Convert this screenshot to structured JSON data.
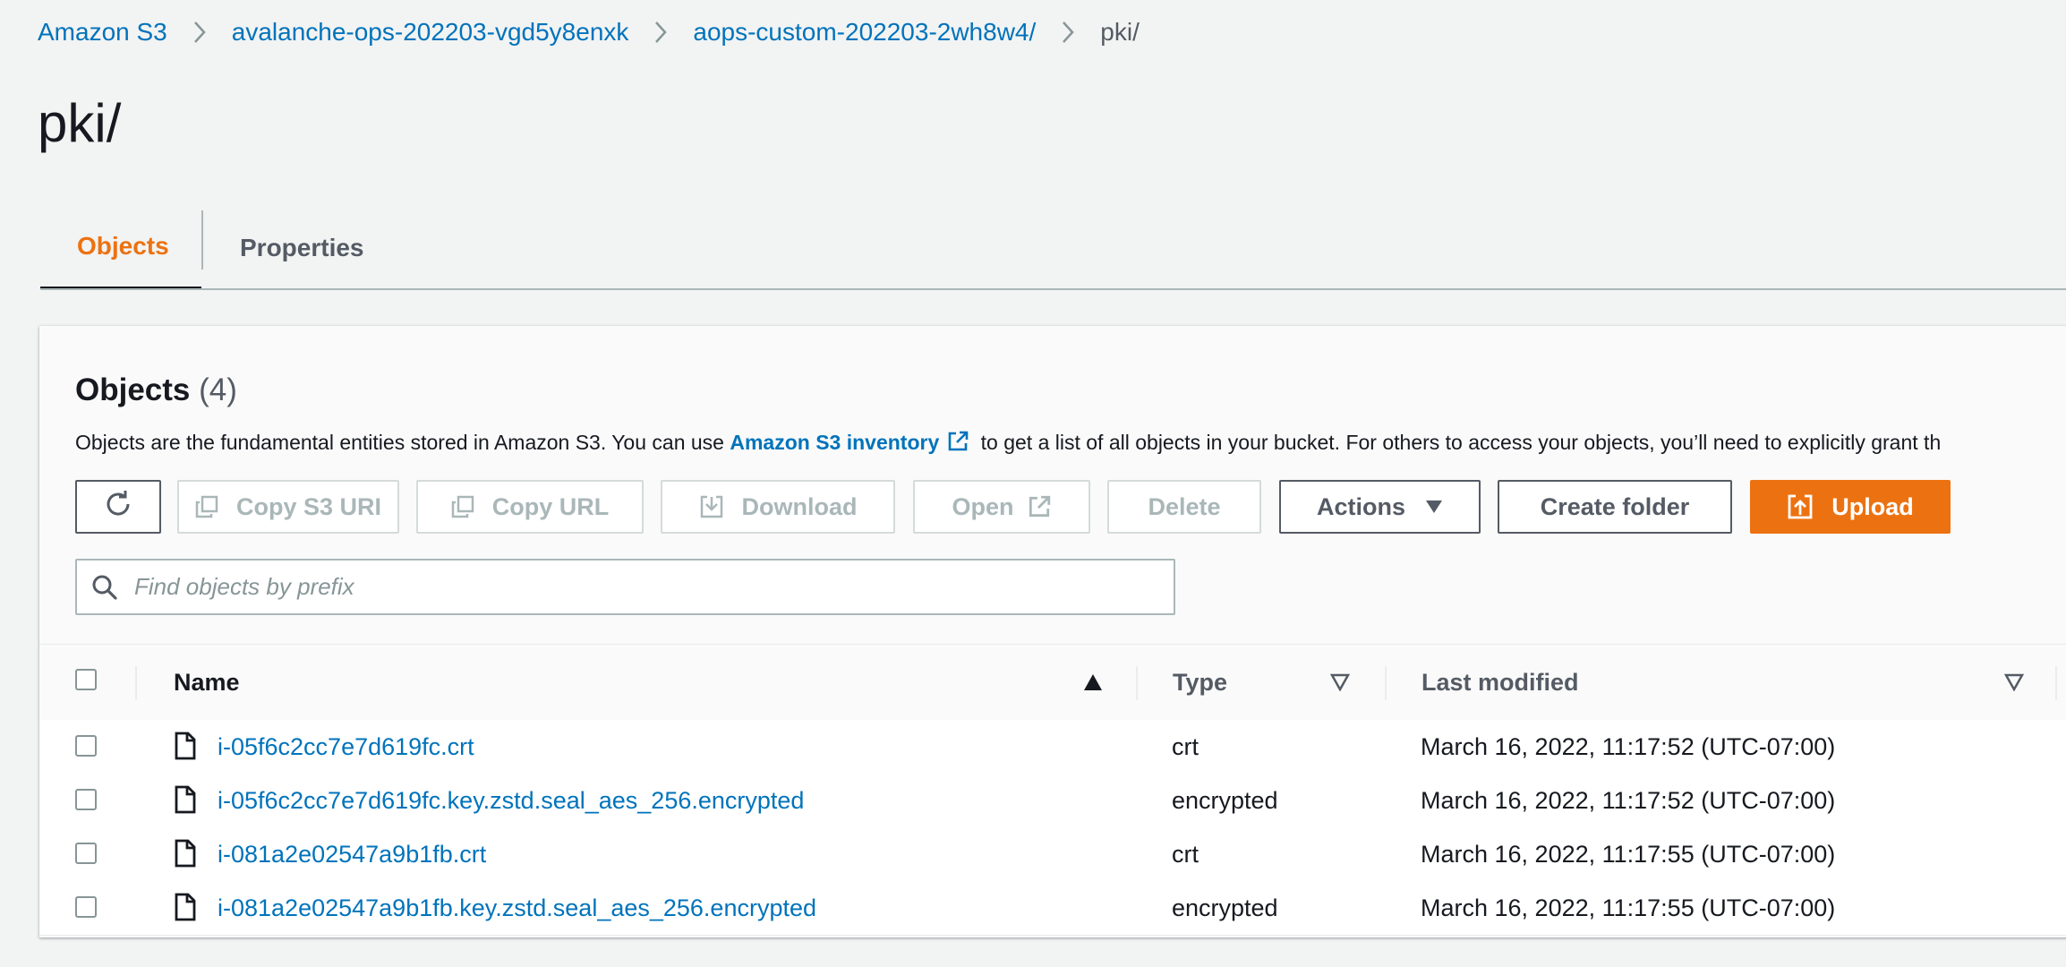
{
  "breadcrumb": [
    {
      "label": "Amazon S3"
    },
    {
      "label": "avalanche-ops-202203-vgd5y8enxk"
    },
    {
      "label": "aops-custom-202203-2wh8w4/"
    },
    {
      "label": "pki/"
    }
  ],
  "page_title": "pki/",
  "tabs": [
    {
      "label": "Objects",
      "active": true
    },
    {
      "label": "Properties",
      "active": false
    }
  ],
  "objects_panel": {
    "title": "Objects",
    "count": "(4)",
    "description_pre": "Objects are the fundamental entities stored in Amazon S3. You can use",
    "description_link": "Amazon S3 inventory",
    "description_post": "to get a list of all objects in your bucket. For others to access your objects, you’ll need to explicitly grant th"
  },
  "toolbar": {
    "refresh_icon": "refresh-icon",
    "copy_s3_uri": "Copy S3 URI",
    "copy_url": "Copy URL",
    "download": "Download",
    "open": "Open",
    "delete": "Delete",
    "actions": "Actions",
    "create_folder": "Create folder",
    "upload": "Upload"
  },
  "search": {
    "placeholder": "Find objects by prefix",
    "value": ""
  },
  "table": {
    "headers": {
      "name": "Name",
      "type": "Type",
      "last_modified": "Last modified"
    },
    "rows": [
      {
        "name": "i-05f6c2cc7e7d619fc.crt",
        "type": "crt",
        "last_modified": "March 16, 2022, 11:17:52 (UTC-07:00)"
      },
      {
        "name": "i-05f6c2cc7e7d619fc.key.zstd.seal_aes_256.encrypted",
        "type": "encrypted",
        "last_modified": "March 16, 2022, 11:17:52 (UTC-07:00)"
      },
      {
        "name": "i-081a2e02547a9b1fb.crt",
        "type": "crt",
        "last_modified": "March 16, 2022, 11:17:55 (UTC-07:00)"
      },
      {
        "name": "i-081a2e02547a9b1fb.key.zstd.seal_aes_256.encrypted",
        "type": "encrypted",
        "last_modified": "March 16, 2022, 11:17:55 (UTC-07:00)"
      }
    ]
  },
  "colors": {
    "link": "#0073bb",
    "accent": "#ec7211",
    "text": "#16191f",
    "muted": "#545b64",
    "disabled": "#aab7b8",
    "background": "#f2f3f3"
  }
}
